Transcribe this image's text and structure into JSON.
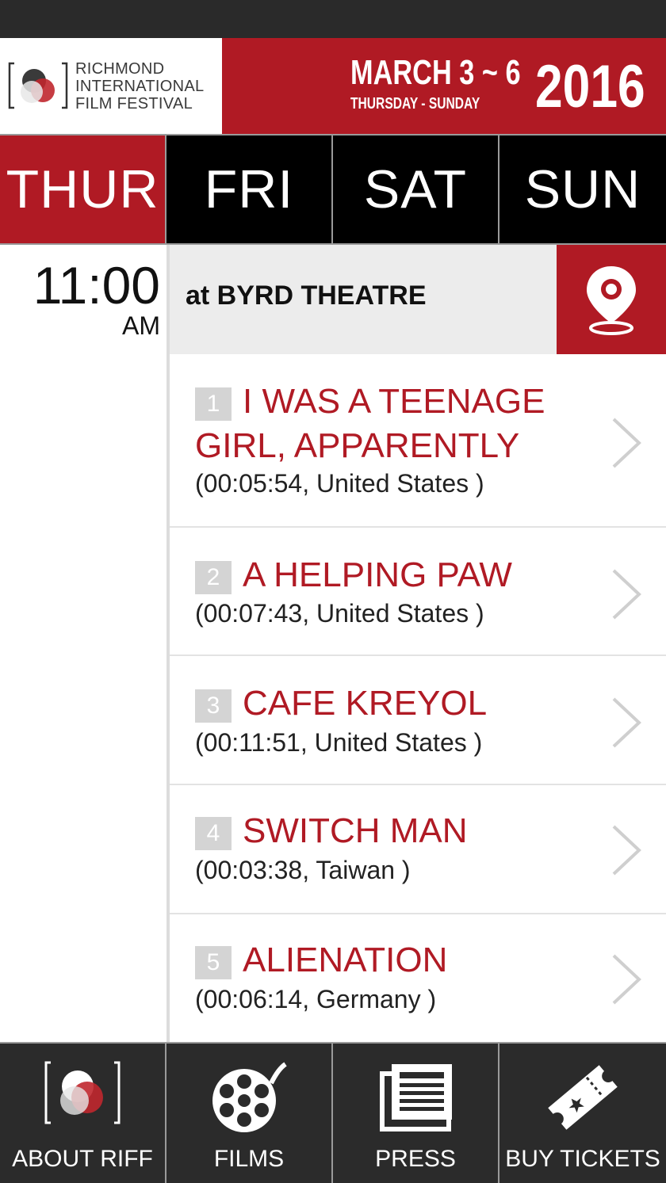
{
  "header": {
    "logo_lines": [
      "RICHMOND",
      "INTERNATIONAL",
      "FILM FESTIVAL"
    ],
    "dates": "MARCH 3 ~ 6",
    "days_range": "THURSDAY - SUNDAY",
    "year": "2016"
  },
  "day_tabs": [
    {
      "label": "THUR",
      "active": true
    },
    {
      "label": "FRI",
      "active": false
    },
    {
      "label": "SAT",
      "active": false
    },
    {
      "label": "SUN",
      "active": false
    }
  ],
  "session": {
    "time": "11:00",
    "ampm": "AM",
    "venue": "at BYRD THEATRE"
  },
  "films": [
    {
      "num": "1",
      "title": "I WAS A TEENAGE GIRL, APPARENTLY",
      "meta": "(00:05:54, United States )"
    },
    {
      "num": "2",
      "title": "A HELPING PAW",
      "meta": "(00:07:43, United States )"
    },
    {
      "num": "3",
      "title": "CAFE KREYOL",
      "meta": "(00:11:51, United States )"
    },
    {
      "num": "4",
      "title": "SWITCH MAN",
      "meta": "(00:03:38, Taiwan )"
    },
    {
      "num": "5",
      "title": "ALIENATION",
      "meta": "(00:06:14, Germany )"
    }
  ],
  "bottom_nav": [
    {
      "label": "ABOUT RIFF",
      "icon": "riff-logo-icon"
    },
    {
      "label": "FILMS",
      "icon": "film-reel-icon"
    },
    {
      "label": "PRESS",
      "icon": "newspaper-icon"
    },
    {
      "label": "BUY TICKETS",
      "icon": "ticket-icon"
    }
  ],
  "colors": {
    "brand_red": "#b01a24",
    "tab_black": "#000000",
    "nav_dark": "#2b2b2b"
  }
}
